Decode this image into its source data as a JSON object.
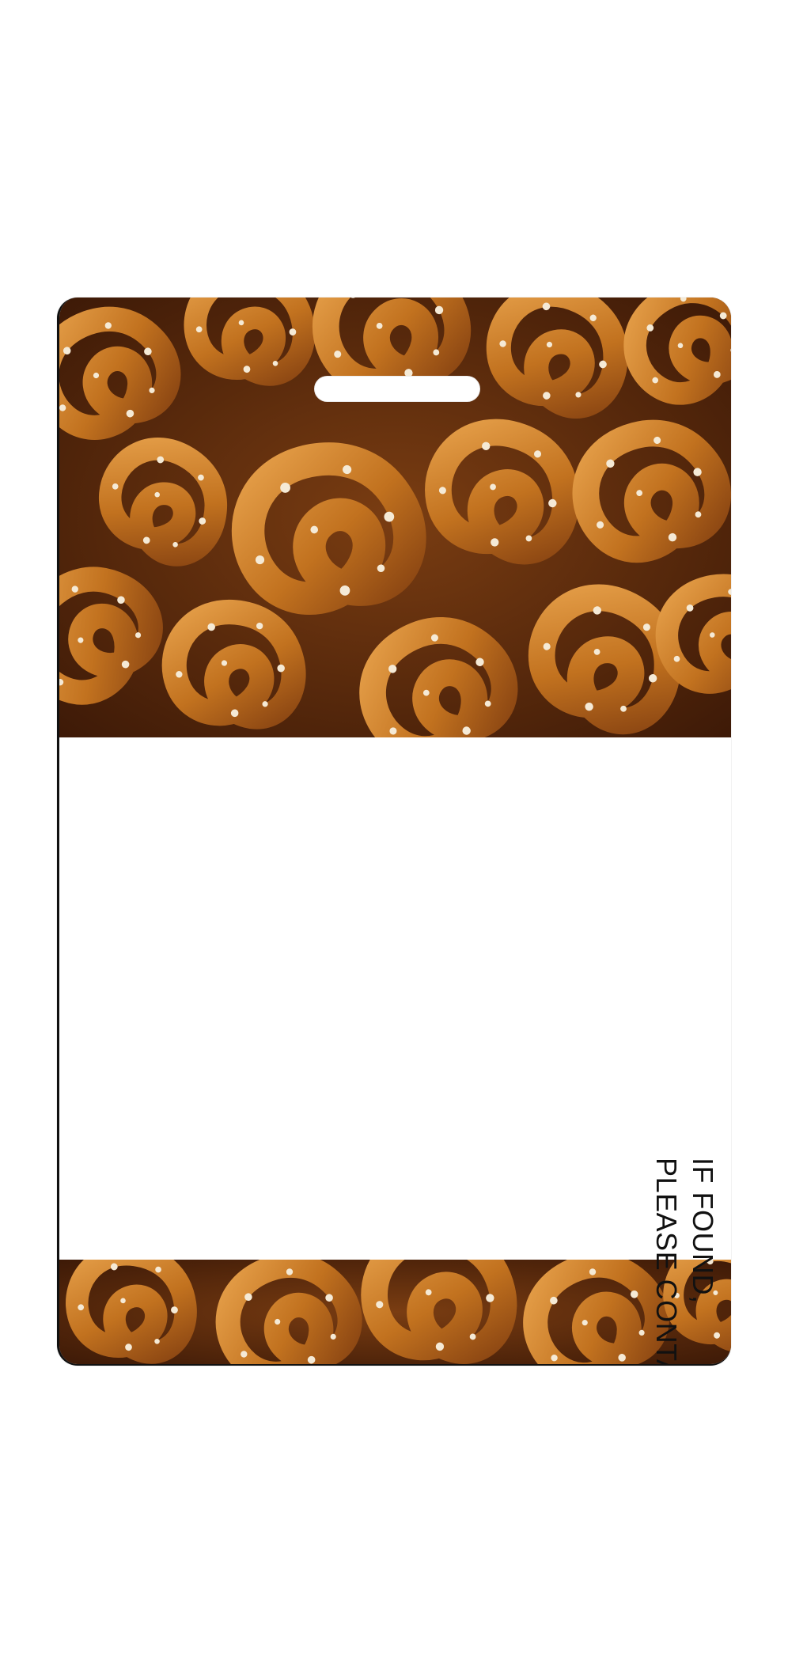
{
  "tag": {
    "line1": "IF FOUND,",
    "line2": "PLEASE CONTACT:",
    "photo_subject": "salted-pretzels-photo"
  },
  "colors": {
    "pretzel_light": "#d98f3a",
    "pretzel_mid": "#b8671f",
    "pretzel_dark": "#5a2a0c",
    "salt": "#f5ead6",
    "text": "#111111"
  }
}
